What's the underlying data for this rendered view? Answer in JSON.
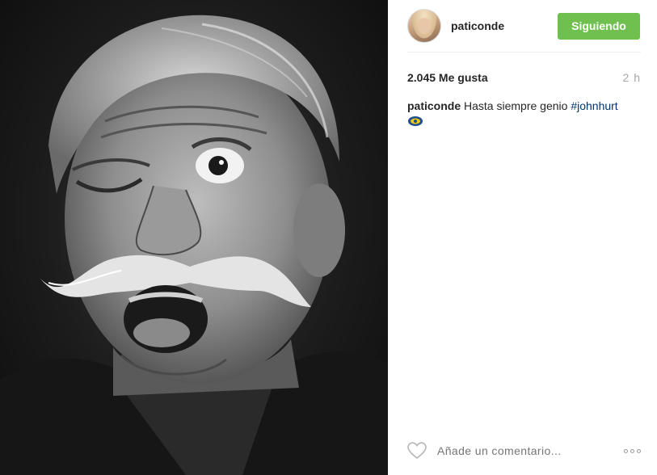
{
  "post": {
    "username": "paticonde",
    "follow_label": "Siguiendo",
    "likes": "2.045 Me gusta",
    "time": "2 h",
    "caption_user": "paticonde",
    "caption_text": " Hasta siempre genio ",
    "caption_hashtag": "#johnhurt",
    "comment_placeholder": "Añade un comentario...",
    "emoji": "cinema-emoji",
    "heart_icon": "heart-outline-icon",
    "more_icon": "more-options-icon",
    "colors": {
      "follow_button": "#70c050",
      "hashtag": "#003569",
      "muted": "#999999"
    }
  }
}
